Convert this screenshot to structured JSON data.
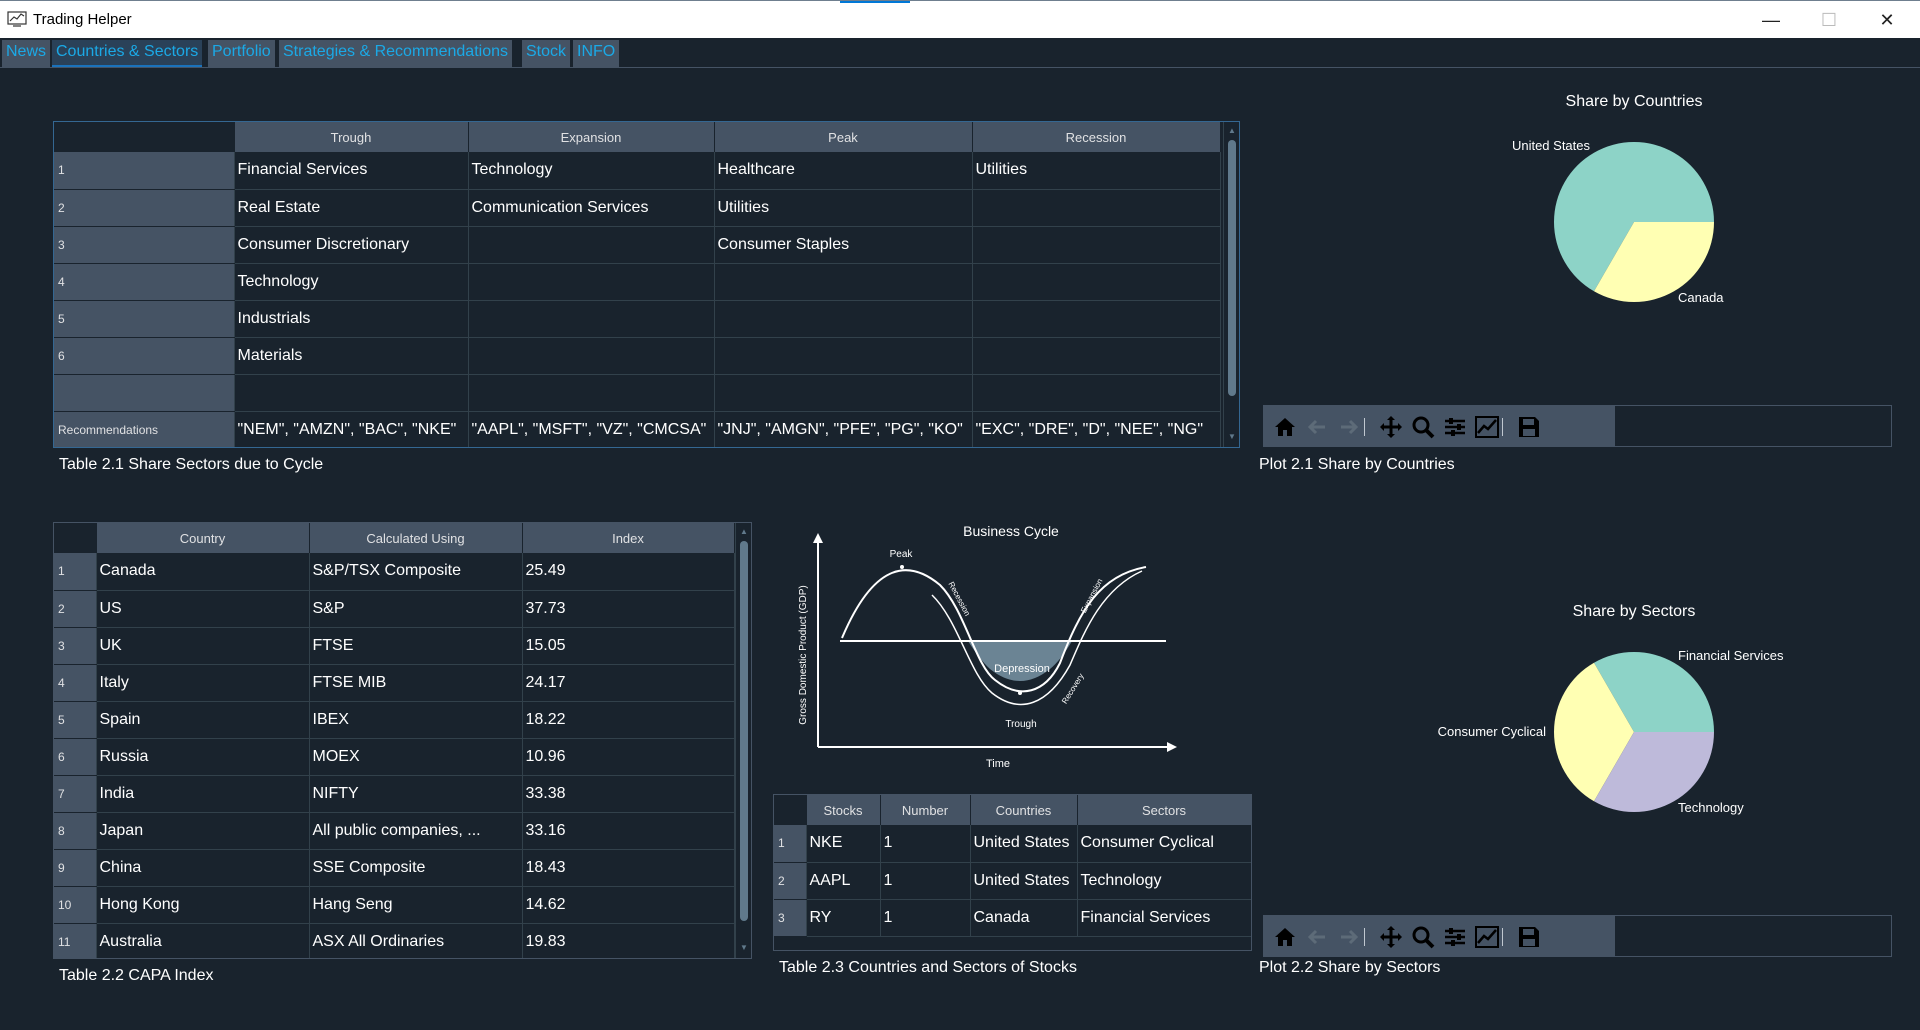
{
  "window": {
    "title": "Trading Helper",
    "minimize": "—",
    "maximize": "☐",
    "close": "✕"
  },
  "tabs": [
    "News",
    "Countries & Sectors",
    "Portfolio",
    "Strategies & Recommendations",
    "Stock",
    "INFO"
  ],
  "active_tab": "Countries & Sectors",
  "table_cycle": {
    "caption": "Table 2.1 Share Sectors due to Cycle",
    "columns": [
      "Trough",
      "Expansion",
      "Peak",
      "Recession"
    ],
    "row_headers": [
      "1",
      "2",
      "3",
      "4",
      "5",
      "6",
      "",
      "Recommendations"
    ],
    "rows": [
      [
        "Financial Services",
        "Technology",
        "Healthcare",
        "Utilities"
      ],
      [
        "Real Estate",
        "Communication Services",
        "Utilities",
        ""
      ],
      [
        "Consumer Discretionary",
        "",
        "Consumer Staples",
        ""
      ],
      [
        "Technology",
        "",
        "",
        ""
      ],
      [
        "Industrials",
        "",
        "",
        ""
      ],
      [
        "Materials",
        "",
        "",
        ""
      ],
      [
        "",
        "",
        "",
        ""
      ],
      [
        "\"NEM\", \"AMZN\", \"BAC\", \"NKE\"",
        "\"AAPL\", \"MSFT\", \"VZ\", \"CMCSA\"",
        "\"JNJ\", \"AMGN\", \"PFE\", \"PG\", \"KO\"",
        "\"EXC\", \"DRE\", \"D\", \"NEE\", \"NG\""
      ]
    ]
  },
  "table_capa": {
    "caption": "Table 2.2 CAPA Index",
    "columns": [
      "Country",
      "Calculated Using",
      "Index"
    ],
    "row_headers": [
      "1",
      "2",
      "3",
      "4",
      "5",
      "6",
      "7",
      "8",
      "9",
      "10",
      "11"
    ],
    "rows": [
      [
        "Canada",
        "S&P/TSX Composite",
        "25.49"
      ],
      [
        "US",
        "S&P",
        "37.73"
      ],
      [
        "UK",
        "FTSE",
        "15.05"
      ],
      [
        "Italy",
        "FTSE MIB",
        "24.17"
      ],
      [
        "Spain",
        "IBEX",
        "18.22"
      ],
      [
        "Russia",
        "MOEX",
        "10.96"
      ],
      [
        "India",
        "NIFTY",
        "33.38"
      ],
      [
        "Japan",
        "All public companies, ...",
        "33.16"
      ],
      [
        "China",
        "SSE Composite",
        "18.43"
      ],
      [
        "Hong Kong",
        "Hang Seng",
        "14.62"
      ],
      [
        "Australia",
        "ASX All Ordinaries",
        "19.83"
      ]
    ]
  },
  "table_stocks": {
    "caption": "Table 2.3 Countries and Sectors of Stocks",
    "columns": [
      "Stocks",
      "Number",
      "Countries",
      "Sectors"
    ],
    "row_headers": [
      "1",
      "2",
      "3"
    ],
    "rows": [
      [
        "NKE",
        "1",
        "United States",
        "Consumer Cyclical"
      ],
      [
        "AAPL",
        "1",
        "United States",
        "Technology"
      ],
      [
        "RY",
        "1",
        "Canada",
        "Financial Services"
      ]
    ]
  },
  "business_cycle": {
    "title": "Business Cycle",
    "xlabel": "Time",
    "ylabel": "Gross Domestic Product (GDP)",
    "labels": {
      "peak": "Peak",
      "recession": "Recession",
      "depression": "Depression",
      "trough": "Trough",
      "recovery": "Recovery",
      "expansion": "Expansion"
    }
  },
  "chart_data": [
    {
      "type": "pie",
      "title": "Share by Countries",
      "labels": [
        "United States",
        "Canada"
      ],
      "values": [
        2,
        1
      ],
      "colors": [
        "#8dd3c7",
        "#ffffb3"
      ]
    },
    {
      "type": "pie",
      "title": "Share by Sectors",
      "labels": [
        "Financial Services",
        "Consumer Cyclical",
        "Technology"
      ],
      "values": [
        1,
        1,
        1
      ],
      "colors": [
        "#8dd3c7",
        "#ffffb3",
        "#bebada"
      ]
    }
  ],
  "plot_captions": [
    "Plot 2.1 Share by Countries",
    "Plot 2.2 Share by Sectors"
  ],
  "toolbar_icons": [
    "home-icon",
    "back-arrow-icon",
    "forward-arrow-icon",
    "pan-move-icon",
    "zoom-magnifier-icon",
    "configure-subplots-icon",
    "edit-axis-icon",
    "save-disk-icon"
  ]
}
